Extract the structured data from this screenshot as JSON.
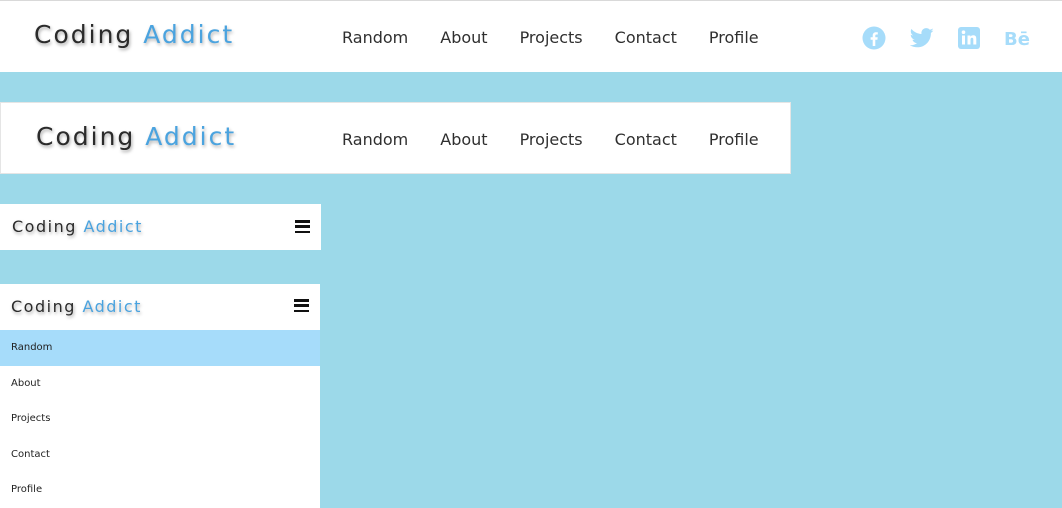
{
  "brand": {
    "word1": "Coding",
    "word2": "Addict"
  },
  "nav": [
    "Random",
    "About",
    "Projects",
    "Contact",
    "Profile"
  ],
  "social": [
    "facebook-icon",
    "twitter-icon",
    "linkedin-icon",
    "behance-icon"
  ],
  "social_color": "#a6dcfa",
  "accent": "#4aa3df",
  "background": "#9cd9e9",
  "mobile_menu": {
    "items": [
      "Random",
      "About",
      "Projects",
      "Contact",
      "Profile"
    ],
    "active_index": 0
  },
  "icon_glyphs": {
    "menu": "hamburger-icon"
  }
}
